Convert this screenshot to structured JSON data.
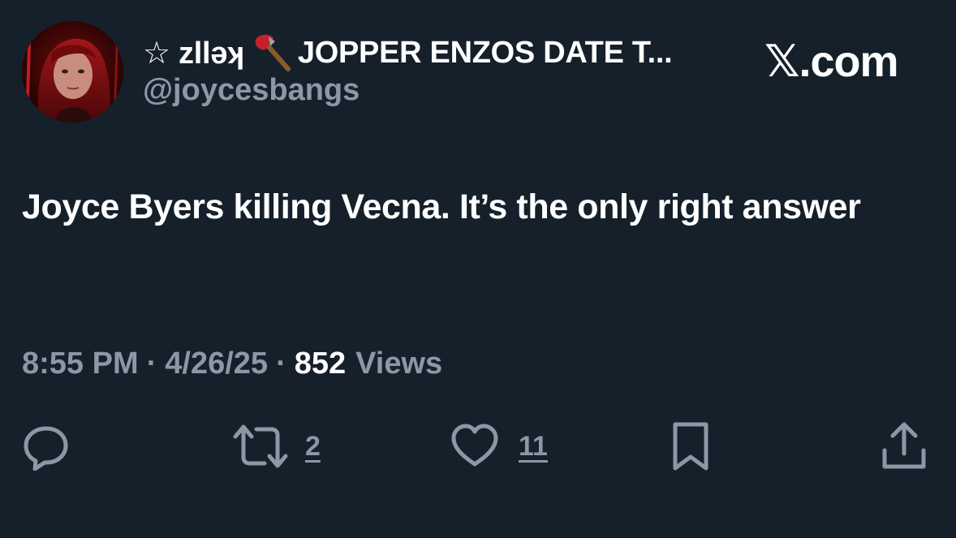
{
  "author": {
    "display_name_prefix": "☆ zllǝʞ",
    "display_name_icon": "axe-icon",
    "display_name_suffix": "JOPPER ENZOS DATE T...",
    "handle": "@joycesbangs",
    "avatar": "avatar-image"
  },
  "brand": {
    "label": "𝕏.com"
  },
  "tweet": {
    "text": "Joyce Byers killing Vecna. It’s the only right answer"
  },
  "meta": {
    "time": "8:55 PM",
    "separator": "·",
    "date": "4/26/25",
    "views_count": "852",
    "views_label": "Views"
  },
  "actions": {
    "reply": {
      "icon": "reply-icon",
      "count": ""
    },
    "retweet": {
      "icon": "retweet-icon",
      "count": "2"
    },
    "like": {
      "icon": "heart-icon",
      "count": "11"
    },
    "bookmark": {
      "icon": "bookmark-icon",
      "count": ""
    },
    "share": {
      "icon": "share-icon",
      "count": ""
    }
  },
  "colors": {
    "background": "#15202b",
    "primary_text": "#ffffff",
    "secondary_text": "#8b98a5"
  }
}
